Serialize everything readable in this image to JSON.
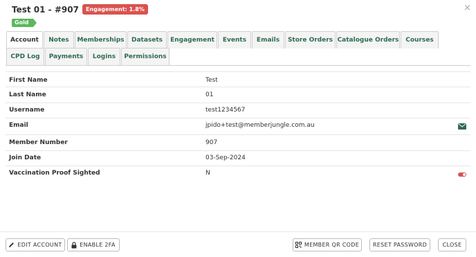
{
  "header": {
    "title": "Test 01 - #907",
    "engagement_badge": "Engagement: 1.8%",
    "tier_badge": "Gold",
    "close_label": "×"
  },
  "tabs": [
    {
      "label": "Account",
      "active": true
    },
    {
      "label": "Notes"
    },
    {
      "label": "Memberships"
    },
    {
      "label": "Datasets"
    },
    {
      "label": "Engagement"
    },
    {
      "label": "Events"
    },
    {
      "label": "Emails"
    },
    {
      "label": "Store Orders"
    },
    {
      "label": "Catalogue Orders"
    },
    {
      "label": "Courses"
    },
    {
      "label": "CPD Log"
    },
    {
      "label": "Payments"
    },
    {
      "label": "Logins"
    },
    {
      "label": "Permissions"
    }
  ],
  "fields": [
    {
      "label": "First Name",
      "value": "Test"
    },
    {
      "label": "Last Name",
      "value": "01"
    },
    {
      "label": "Username",
      "value": "test1234567"
    },
    {
      "label": "Email",
      "value": "jpido+test@memberjungle.com.au"
    },
    {
      "label": "Member Number",
      "value": "907"
    },
    {
      "label": "Join Date",
      "value": "03-Sep-2024"
    },
    {
      "label": "Vaccination Proof Sighted",
      "value": "N"
    }
  ],
  "buttons": {
    "edit_account": "EDIT ACCOUNT",
    "enable_2fa": "ENABLE 2FA",
    "member_qr_code": "MEMBER QR CODE",
    "reset_password": "RESET PASSWORD",
    "close": "CLOSE"
  },
  "colors": {
    "tab_text": "#2e6b4f",
    "engagement_badge": "#d9534f",
    "gold_badge": "#5cb85c",
    "toggle_off": "#d9534f"
  }
}
